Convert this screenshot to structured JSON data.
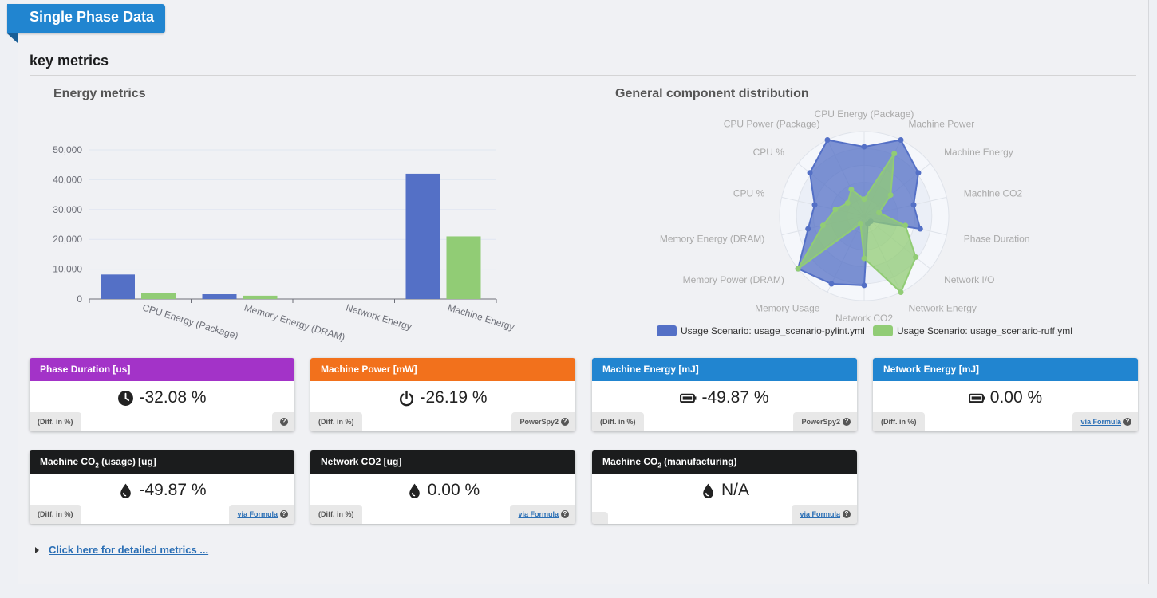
{
  "header": {
    "ribbon_title": "Single Phase Data",
    "section_title": "key metrics"
  },
  "bar_chart": {
    "title": "Energy metrics"
  },
  "radar_chart": {
    "title": "General component distribution"
  },
  "chart_data": [
    {
      "type": "bar",
      "title": "Energy metrics",
      "categories": [
        "CPU Energy (Package)",
        "Memory Energy (DRAM)",
        "Network Energy",
        "Machine Energy"
      ],
      "series": [
        {
          "name": "Usage Scenario: usage_scenario-pylint.yml",
          "color": "#5470c6",
          "values": [
            8200,
            1600,
            0,
            42000
          ]
        },
        {
          "name": "Usage Scenario: usage_scenario-ruff.yml",
          "color": "#91cc75",
          "values": [
            2000,
            1100,
            0,
            21000
          ]
        }
      ],
      "yticks": [
        "0",
        "10,000",
        "20,000",
        "30,000",
        "40,000",
        "50,000"
      ],
      "ylim": [
        0,
        50000
      ]
    },
    {
      "type": "radar",
      "title": "General component distribution",
      "indicators": [
        "CPU Energy (Package)",
        "Machine Power",
        "Machine Energy",
        "Machine CO2",
        "Phase Duration",
        "Network I/O",
        "Network Energy",
        "Network CO2",
        "Memory Usage",
        "Memory Power (DRAM)",
        "Memory Energy (DRAM)",
        "CPU %",
        "CPU %",
        "CPU Power (Package)"
      ],
      "series": [
        {
          "name": "Usage Scenario: usage_scenario-pylint.yml",
          "color": "#5470c6",
          "values": [
            0.82,
            1.0,
            0.82,
            0.6,
            0.68,
            0.1,
            0.1,
            0.82,
            0.89,
            1.0,
            0.68,
            0.6,
            0.82,
            1.0
          ]
        },
        {
          "name": "Usage Scenario: usage_scenario-ruff.yml",
          "color": "#91cc75",
          "values": [
            0.2,
            0.82,
            0.4,
            0.18,
            0.5,
            0.78,
            1.0,
            0.5,
            0.1,
            1.0,
            0.5,
            0.35,
            0.25,
            0.35
          ]
        }
      ],
      "legend_position": "bottom"
    }
  ],
  "cards_row1": [
    {
      "title": "Phase Duration [us]",
      "color": "#a333c8",
      "icon": "clock-icon",
      "value": "-32.08 %",
      "diff": "(Diff. in %)",
      "source": ""
    },
    {
      "title": "Machine Power [mW]",
      "color": "#f2711c",
      "icon": "power-icon",
      "value": "-26.19 %",
      "diff": "(Diff. in %)",
      "source": "PowerSpy2"
    },
    {
      "title": "Machine Energy [mJ]",
      "color": "#2185d0",
      "icon": "battery-icon",
      "value": "-49.87 %",
      "diff": "(Diff. in %)",
      "source": "PowerSpy2"
    },
    {
      "title": "Network Energy [mJ]",
      "color": "#2185d0",
      "icon": "battery-icon",
      "value": "0.00 %",
      "diff": "(Diff. in %)",
      "source": "via Formula"
    }
  ],
  "cards_row2": [
    {
      "title_main": "Machine CO",
      "title_sub": "2",
      "title_rest": " (usage) [ug]",
      "color": "#1b1c1d",
      "icon": "drop-icon",
      "value": "-49.87 %",
      "diff": "(Diff. in %)",
      "source": "via Formula"
    },
    {
      "title_main": "Network CO2 [ug]",
      "title_sub": "",
      "title_rest": "",
      "color": "#1b1c1d",
      "icon": "drop-icon",
      "value": "0.00 %",
      "diff": "(Diff. in %)",
      "source": "via Formula"
    },
    {
      "title_main": "Machine CO",
      "title_sub": "2",
      "title_rest": " (manufacturing)",
      "color": "#1b1c1d",
      "icon": "drop-icon",
      "value": "N/A",
      "diff": "",
      "source": "via Formula"
    }
  ],
  "details_link": "Click here for detailed metrics ..."
}
